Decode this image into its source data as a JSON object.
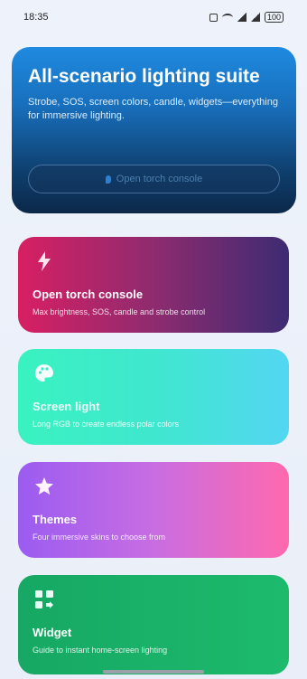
{
  "status": {
    "time": "18:35",
    "battery": "100"
  },
  "hero": {
    "title": "All-scenario lighting suite",
    "subtitle": "Strobe, SOS, screen colors, candle, widgets—everything for immersive lighting.",
    "button_label": "Open torch console"
  },
  "cards": [
    {
      "title": "Open torch console",
      "description": "Max brightness, SOS, candle and strobe control",
      "icon": "flashlight-icon"
    },
    {
      "title": "Screen light",
      "description": "Long RGB to create endless polar colors",
      "icon": "palette-icon"
    },
    {
      "title": "Themes",
      "description": "Four immersive skins to choose from",
      "icon": "star-icon"
    },
    {
      "title": "Widget",
      "description": "Guide to instant home-screen lighting",
      "icon": "widgets-icon"
    }
  ],
  "colors": {
    "hero_top": "#1f8ae0",
    "hero_bottom": "#0b2849",
    "torch_card": "#d81f63",
    "screen_light_card": "#3af2c0",
    "themes_card": "#c86de2",
    "widget_card": "#1dba6c"
  }
}
